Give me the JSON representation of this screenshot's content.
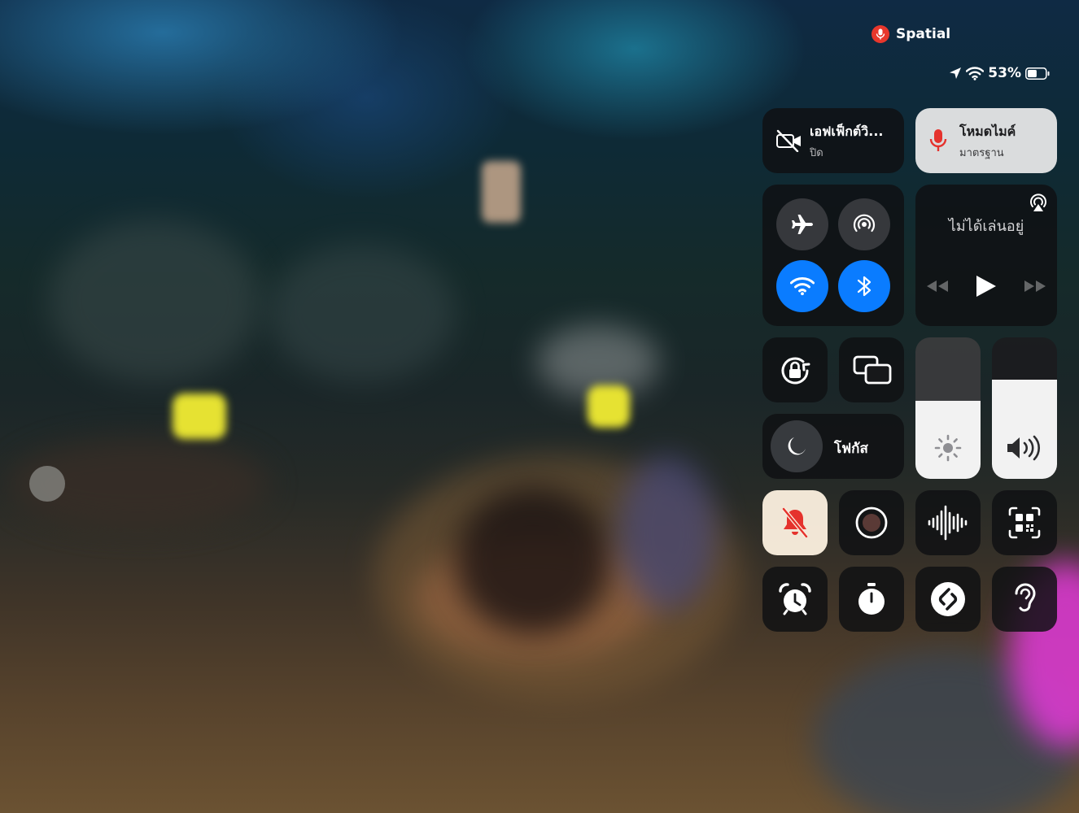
{
  "status": {
    "recording_label": "Spatial",
    "battery_percent": "53%",
    "battery_level": 0.53
  },
  "control_center": {
    "video_effects": {
      "title": "เอฟเฟ็กต์วิ...",
      "subtitle": "ปิด"
    },
    "mic_mode": {
      "title": "โหมดไมค์",
      "subtitle": "มาตรฐาน"
    },
    "now_playing": {
      "title": "ไม่ได้เล่นอยู่"
    },
    "focus": {
      "label": "โฟกัส"
    },
    "brightness_level": 0.55,
    "volume_level": 0.7
  },
  "colors": {
    "accent_blue": "#0a7cff",
    "record_red": "#e8372c",
    "silent_red": "#e5322d",
    "hearing_magenta": "#e23ad8"
  },
  "icons": [
    "microphone-icon",
    "location-icon",
    "wifi-icon",
    "battery-icon",
    "video-off-icon",
    "airplane-icon",
    "airdrop-icon",
    "bluetooth-icon",
    "airplay-icon",
    "rewind-icon",
    "play-icon",
    "fast-forward-icon",
    "rotation-lock-icon",
    "screen-mirroring-icon",
    "moon-icon",
    "sun-icon",
    "speaker-icon",
    "bell-slash-icon",
    "screen-record-icon",
    "waveform-icon",
    "qr-code-icon",
    "alarm-icon",
    "timer-icon",
    "shazam-icon",
    "ear-icon"
  ]
}
